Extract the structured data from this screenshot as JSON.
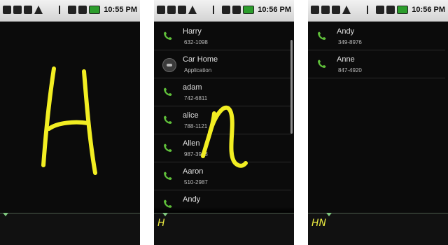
{
  "screens": [
    {
      "status": {
        "time": "10:55 PM"
      },
      "typed_text": "",
      "contacts": []
    },
    {
      "status": {
        "time": "10:56 PM"
      },
      "typed_text": "H",
      "contacts": [
        {
          "name": "Harry",
          "detail": "632-1098",
          "icon": "phone-icon"
        },
        {
          "name": "Car Home",
          "detail": "Application",
          "icon": "car-home-icon"
        },
        {
          "name": "adam",
          "detail": "742-6811",
          "icon": "phone-icon"
        },
        {
          "name": "alice",
          "detail": "788-1121",
          "icon": "phone-icon"
        },
        {
          "name": "Allen",
          "detail": "987-3923",
          "icon": "phone-icon"
        },
        {
          "name": "Aaron",
          "detail": "510-2987",
          "icon": "phone-icon"
        },
        {
          "name": "Andy",
          "detail": "",
          "icon": "phone-icon"
        }
      ]
    },
    {
      "status": {
        "time": "10:56 PM"
      },
      "typed_text": "HN",
      "contacts": [
        {
          "name": "Andy",
          "detail": "349-8976",
          "icon": "phone-icon"
        },
        {
          "name": "Anne",
          "detail": "847-4920",
          "icon": "phone-icon"
        }
      ]
    }
  ],
  "colors": {
    "gesture_stroke": "#f2ee22",
    "phone_icon": "#5fbf3a",
    "typed_text": "#e8e840"
  }
}
